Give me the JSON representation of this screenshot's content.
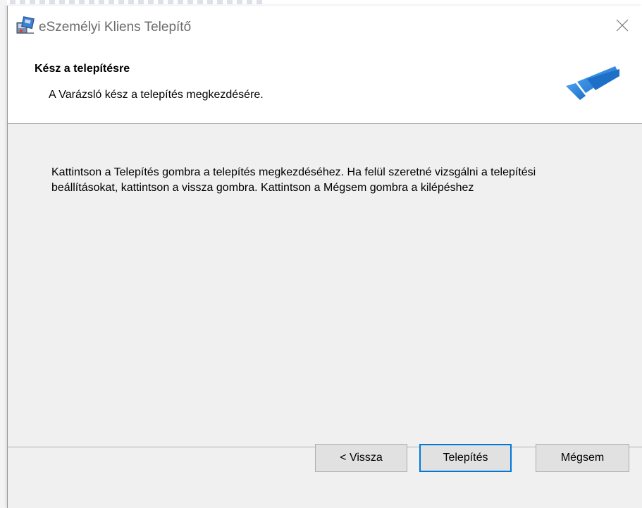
{
  "window": {
    "title": "eSzemélyi Kliens Telepítő"
  },
  "header": {
    "title": "Kész a telepítésre",
    "subtitle": "A Varázsló kész a telepítés megkezdésére."
  },
  "body": {
    "text": "Kattintson a Telepítés gombra a telepítés megkezdéséhez.  Ha felül szeretné vizsgálni a telepítési beállításokat, kattintson a vissza gombra. Kattintson a Mégsem gombra a kilépéshez"
  },
  "buttons": {
    "back_label": "< Vissza",
    "install_label": "Telepítés",
    "cancel_label": "Mégsem"
  },
  "colors": {
    "accent": "#0078d7",
    "logo_blue": "#1e6fc8",
    "logo_light": "#4aa3f0"
  },
  "icons": {
    "app": "installer-package-icon",
    "close": "close-icon",
    "brand": "brand-logo-icon"
  }
}
